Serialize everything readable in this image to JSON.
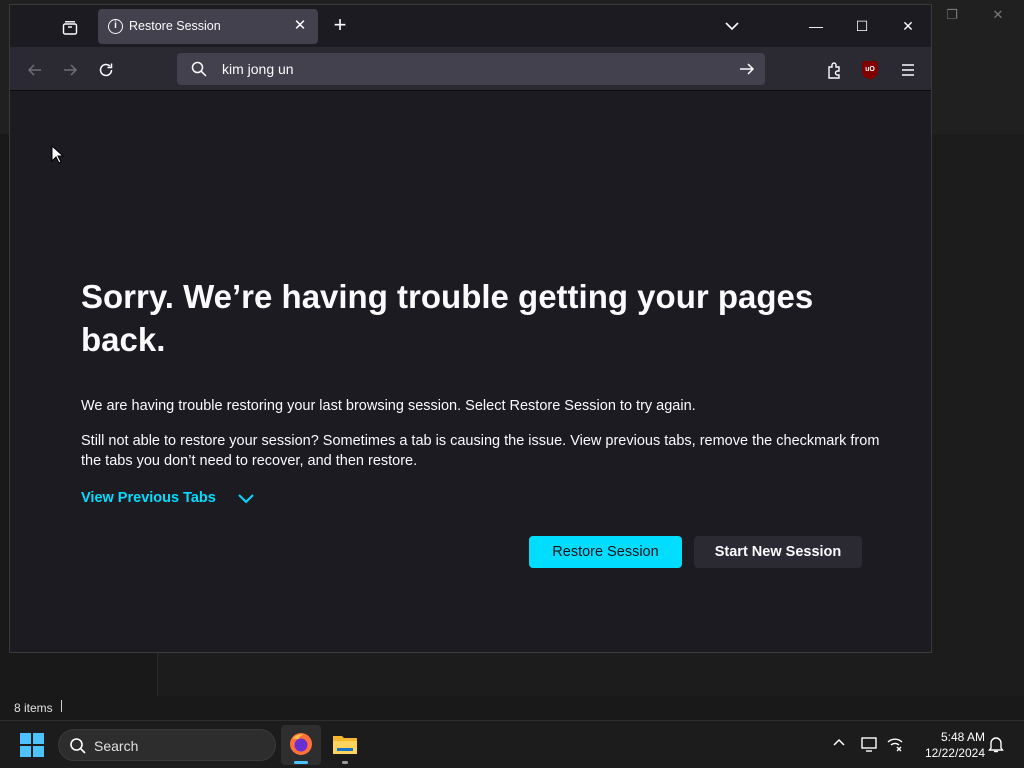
{
  "browser": {
    "tab": {
      "title": "Restore Session",
      "close_glyph": "✕"
    },
    "new_tab_glyph": "+",
    "window_controls": {
      "minimize": "—",
      "maximize": "☐",
      "close": "✕"
    },
    "url_value": "kim jong un",
    "ublock_label": "uO"
  },
  "content": {
    "title": "Sorry. We’re having trouble getting your pages back.",
    "paragraph1": "We are having trouble restoring your last browsing session. Select Restore Session to try again.",
    "paragraph2": "Still not able to restore your session? Sometimes a tab is causing the issue. View previous tabs, remove the checkmark from the tabs you don’t need to recover, and then restore.",
    "view_previous_tabs": "View Previous Tabs",
    "restore_button": "Restore Session",
    "new_session_button": "Start New Session"
  },
  "explorer": {
    "status_items": "8 items"
  },
  "taskbar": {
    "search_label": "Search",
    "time": "5:48 AM",
    "date": "12/22/2024"
  },
  "colors": {
    "accent": "#00ddff",
    "content_bg": "#1c1b22",
    "toolbar_bg": "#2b2a33",
    "taskbar_indicator": "#4cc2ff"
  }
}
